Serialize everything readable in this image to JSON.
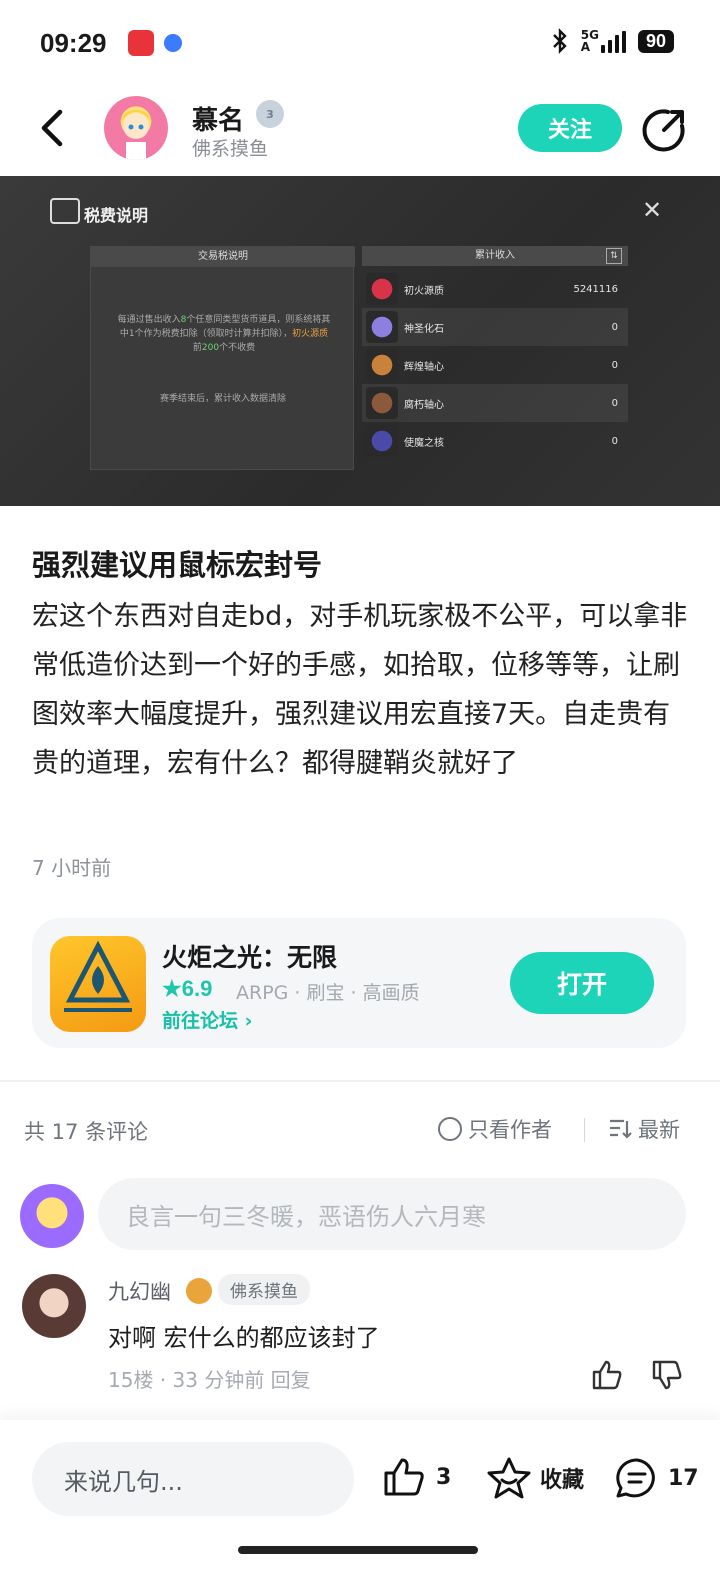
{
  "status_bar": {
    "time": "09:29",
    "network": "5G",
    "network_sub": "A",
    "battery": "90"
  },
  "header": {
    "author_name": "慕名",
    "level": "3",
    "author_tag": "佛系摸鱼",
    "follow_label": "关注"
  },
  "post_image": {
    "title": "税费说明",
    "left_header": "交易税说明",
    "left_text_1": "每通过售出收入",
    "left_text_hl1": "8",
    "left_text_2": "个任意同类型货币道具，则系统将其中1个作为税费扣除（领取时计算并扣除），",
    "left_text_hl2": "初火源质",
    "left_text_3": "前",
    "left_text_hl3": "200",
    "left_text_4": "个不收费",
    "left_foot": "赛季结束后，累计收入数据清除",
    "right_header": "累计收入",
    "items": [
      {
        "name": "初火源质",
        "value": "5241116",
        "color": "#d9334a"
      },
      {
        "name": "神圣化石",
        "value": "0",
        "color": "#8d7fe0"
      },
      {
        "name": "辉煌轴心",
        "value": "0",
        "color": "#c9823a"
      },
      {
        "name": "腐朽轴心",
        "value": "0",
        "color": "#8a5a3a"
      },
      {
        "name": "使魔之核",
        "value": "0",
        "color": "#4a4aa8"
      }
    ]
  },
  "post": {
    "title": "强烈建议用鼠标宏封号",
    "body": "宏这个东西对自走bd，对手机玩家极不公平，可以拿非常低造价达到一个好的手感，如拾取，位移等等，让刷图效率大幅度提升，强烈建议用宏直接7天。自走贵有贵的道理，宏有什么？都得腱鞘炎就好了",
    "time": "7 小时前"
  },
  "game": {
    "name": "火炬之光：无限",
    "rating": "★6.9",
    "tags": "ARPG · 刷宝 · 高画质",
    "forum": "前往论坛 ›",
    "open_label": "打开"
  },
  "comments_header": {
    "count": "共 17 条评论",
    "author_only": "只看作者",
    "sort": "最新"
  },
  "comment_input": {
    "placeholder": "良言一句三冬暖，恶语伤人六月寒"
  },
  "comments": [
    {
      "name": "九幻幽",
      "tag": "佛系摸鱼",
      "text": "对啊 宏什么的都应该封了",
      "meta": "15楼 · 33 分钟前   回复"
    }
  ],
  "bottom_bar": {
    "placeholder": "来说几句...",
    "likes": "3",
    "favorite": "收藏",
    "comments": "17"
  }
}
